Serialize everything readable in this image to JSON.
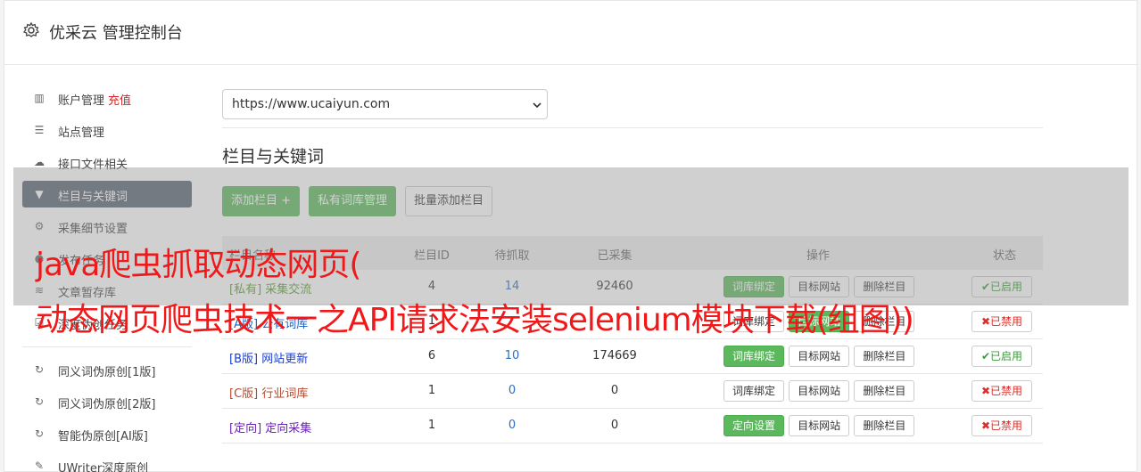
{
  "header": {
    "title": "优采云 管理控制台"
  },
  "sidebar": {
    "items": [
      {
        "label": "账户管理",
        "extra": "充值",
        "icon": "bar-chart-icon"
      },
      {
        "label": "站点管理",
        "icon": "server-icon"
      },
      {
        "label": "接口文件相关",
        "icon": "cloud-upload-icon"
      },
      {
        "label": "栏目与关键词",
        "icon": "filter-icon",
        "active": true
      },
      {
        "label": "采集细节设置",
        "icon": "cogs-icon"
      },
      {
        "label": "发布任务",
        "icon": "circle-icon"
      },
      {
        "label": "文章暂存库",
        "icon": "database-icon"
      },
      {
        "label": "深度伪创任务",
        "icon": "checkbox-icon"
      }
    ],
    "items2": [
      {
        "label": "同义词伪原创[1版]",
        "icon": "refresh-icon"
      },
      {
        "label": "同义词伪原创[2版]",
        "icon": "refresh-icon"
      },
      {
        "label": "智能伪原创[AI版]",
        "icon": "refresh-icon"
      },
      {
        "label": "UWriter深度原创",
        "icon": "edit-icon"
      }
    ]
  },
  "main": {
    "site_select": {
      "value": "https://www.ucaiyun.com"
    },
    "section_title": "栏目与关键词",
    "buttons": {
      "add_column": "添加栏目 +",
      "private_lib": "私有词库管理",
      "batch_add": "批量添加栏目"
    },
    "table": {
      "headers": {
        "name": "栏目名称",
        "id": "栏目ID",
        "pending": "待抓取",
        "collected": "已采集",
        "ops": "操作",
        "status": "状态"
      },
      "rows": [
        {
          "tag": "[私有]",
          "name": "采集交流",
          "id": "4",
          "pending": "14",
          "collected": "92460",
          "op1": "词库绑定",
          "op2": "目标网站",
          "op3": "删除栏目",
          "status": "✔已启用",
          "on": true
        },
        {
          "tag": "[A版]",
          "name": "公有词库",
          "id": "1",
          "pending": "",
          "collected": "",
          "op1": "词库绑定",
          "op2": "目标网站",
          "op3": "删除栏目",
          "status": "✖已禁用",
          "on": false
        },
        {
          "tag": "[B版]",
          "name": "网站更新",
          "id": "6",
          "pending": "10",
          "collected": "174669",
          "op1": "词库绑定",
          "op2": "目标网站",
          "op3": "删除栏目",
          "status": "✔已启用",
          "on": true
        },
        {
          "tag": "[C版]",
          "name": "行业词库",
          "id": "1",
          "pending": "0",
          "collected": "0",
          "op1": "词库绑定",
          "op2": "目标网站",
          "op3": "删除栏目",
          "status": "✖已禁用",
          "on": false
        },
        {
          "tag": "[定向]",
          "name": "定向采集",
          "id": "1",
          "pending": "0",
          "collected": "0",
          "op1": "定向设置",
          "op2": "目标网站",
          "op3": "删除栏目",
          "status": "✖已禁用",
          "on": false
        }
      ]
    }
  },
  "overlay": {
    "line1": "java爬虫抓取动态网页(",
    "line2": "动态网页爬虫技术一之API请求法安装selenium模块下载(组图))"
  },
  "colors": {
    "active_nav": "#566370",
    "green": "#5cb85c",
    "overlay_text": "#f01818"
  }
}
